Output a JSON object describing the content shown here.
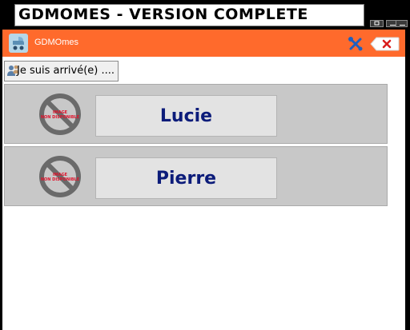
{
  "banner": {
    "title": "GDMOMES - VERSION COMPLETE"
  },
  "window": {
    "title": "GDMOmes"
  },
  "toolbar": {
    "arrive_label": "Je suis arrivé(e) ...."
  },
  "people": [
    {
      "name": "Lucie",
      "image_text_1": "IMAGE",
      "image_text_2": "NON DISPONIBLE"
    },
    {
      "name": "Pierre",
      "image_text_1": "IMAGE",
      "image_text_2": "NON DISPONIBLE"
    }
  ],
  "colors": {
    "titlebar": "#ff6a2c",
    "row_background": "#c8c8c8",
    "name_text": "#0c1c7a",
    "placeholder_text": "#e0122b"
  },
  "icons": {
    "app": "stroller-icon",
    "tools": "tools-icon",
    "close": "close-icon",
    "arrive": "users-icon",
    "placeholder": "no-image-icon"
  }
}
